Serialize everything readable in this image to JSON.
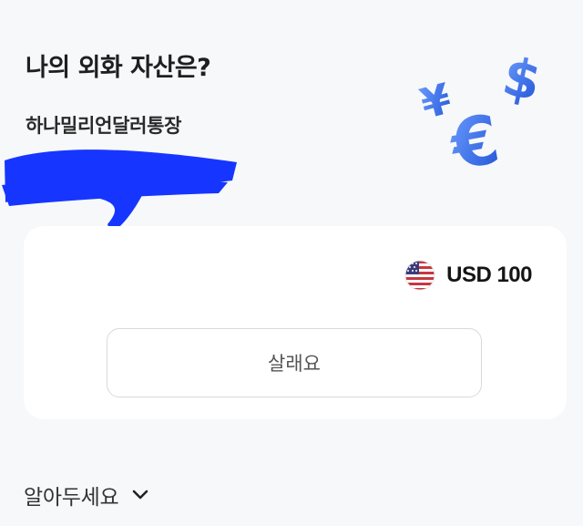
{
  "header": {
    "title": "나의 외화 자산은?",
    "account_name": "하나밀리언달러통장"
  },
  "card": {
    "currency_code": "USD",
    "amount": "100",
    "balance_text": "USD 100",
    "buy_label": "살래요"
  },
  "notice": {
    "label": "알아두세요"
  },
  "colors": {
    "background": "#f7f8f9",
    "card": "#ffffff",
    "illustration_blue": "#2f6bf2",
    "redaction_blue": "#1636ff"
  },
  "icons": {
    "flag": "us-flag-icon",
    "currency_illustration": "currency-symbols-icon",
    "chevron": "chevron-down-icon"
  }
}
